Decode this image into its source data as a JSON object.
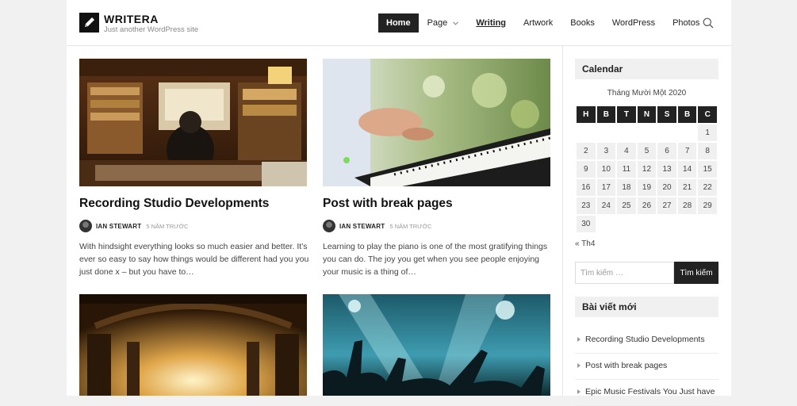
{
  "site": {
    "title": "WRITERA",
    "tagline": "Just another WordPress site"
  },
  "nav": [
    {
      "label": "Home"
    },
    {
      "label": "Page"
    },
    {
      "label": "Writing"
    },
    {
      "label": "Artwork"
    },
    {
      "label": "Books"
    },
    {
      "label": "WordPress"
    },
    {
      "label": "Photos"
    }
  ],
  "posts": [
    {
      "title": "Recording Studio Developments",
      "author": "IAN STEWART",
      "date": "5 NĂM TRƯỚC",
      "excerpt": "With hindsight everything looks so much easier and better. It’s ever so easy to say how things would be different had you you just done x – but you have to…"
    },
    {
      "title": "Post with break pages",
      "author": "IAN STEWART",
      "date": "5 NĂM TRƯỚC",
      "excerpt": "Learning to play the piano is one of the most gratifying things you can do. The joy you get when you see people enjoying your music is a thing of…"
    }
  ],
  "calendar": {
    "heading": "Calendar",
    "caption": "Tháng Mười Một 2020",
    "weekdays": [
      "H",
      "B",
      "T",
      "N",
      "S",
      "B",
      "C"
    ],
    "prev_link": "« Th4"
  },
  "search": {
    "placeholder": "Tìm kiếm …",
    "button": "Tìm kiếm"
  },
  "recent": {
    "heading": "Bài viết mới",
    "items": [
      "Recording Studio Developments",
      "Post with break pages",
      "Epic Music Festivals You Just have"
    ]
  },
  "colors": {
    "dark": "#222222",
    "widget_bg": "#f0f0f0",
    "border": "#e6e6e6"
  }
}
